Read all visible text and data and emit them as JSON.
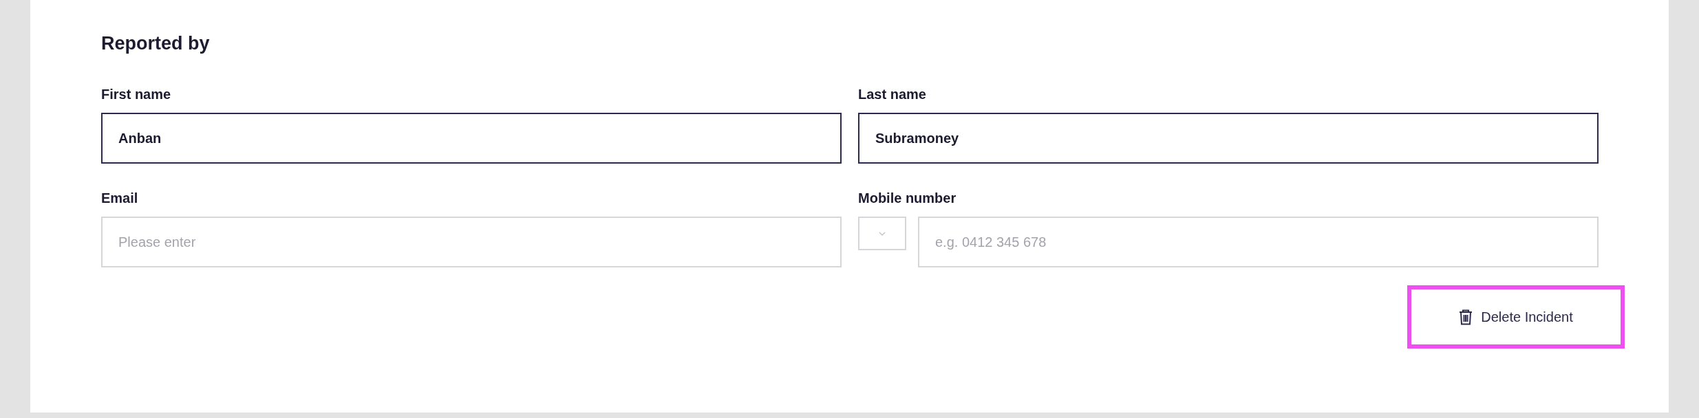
{
  "section": {
    "title": "Reported by"
  },
  "fields": [
    {
      "kind": "text",
      "label": "First name",
      "value": "Anban"
    },
    {
      "kind": "text",
      "label": "Last name",
      "value": "Subramoney"
    },
    {
      "kind": "text",
      "label": "Email",
      "placeholder": "Please enter"
    },
    {
      "kind": "phone",
      "label": "Mobile number",
      "placeholder": "e.g. 0412 345 678"
    }
  ],
  "actions": [
    {
      "label": "Delete Incident"
    }
  ]
}
